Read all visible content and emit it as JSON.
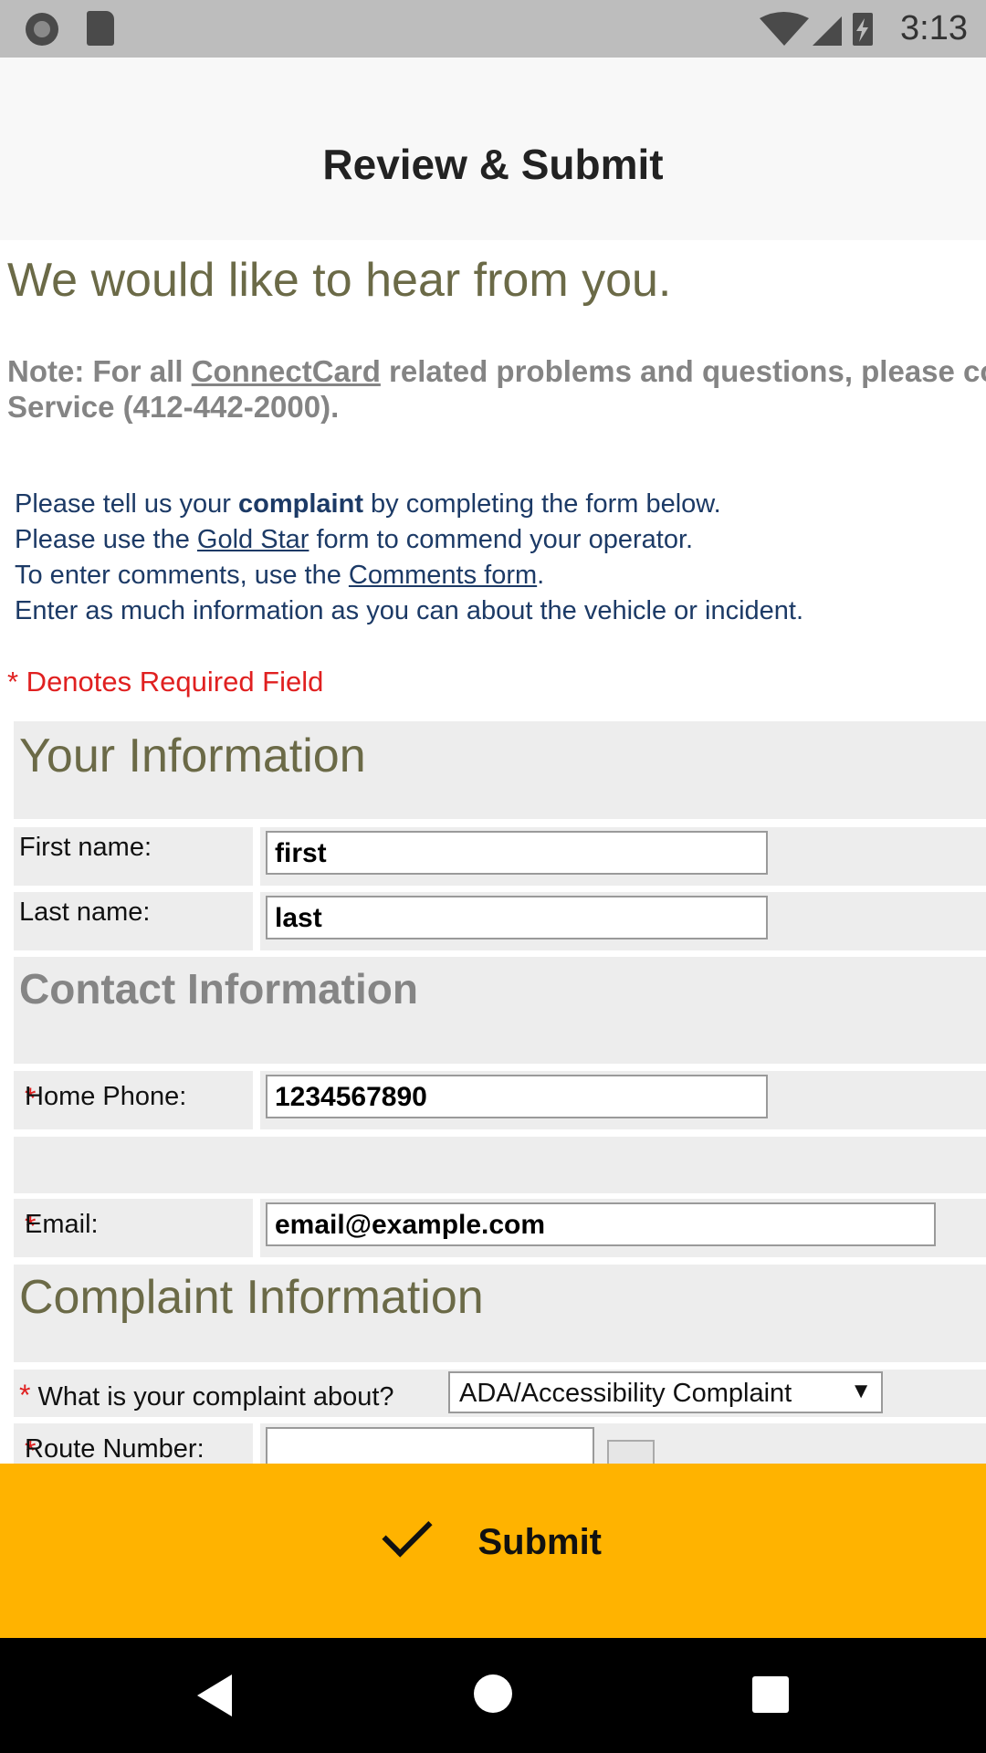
{
  "status_bar": {
    "time": "3:13",
    "icons": [
      "notification-circle-icon",
      "sd-card-icon",
      "wifi-icon",
      "signal-icon",
      "battery-charging-icon"
    ]
  },
  "header": {
    "title": "Review & Submit"
  },
  "intro": {
    "heading": "We would like to hear from you.",
    "note_prefix": "Note: For all ",
    "note_link": "ConnectCard",
    "note_line1_rest": " related problems and questions, please cont",
    "note_line2": "Service (412-442-2000).",
    "line1_a": "Please tell us your ",
    "line1_bold": "complaint",
    "line1_b": " by completing the form below.",
    "line2_a": "Please use the ",
    "line2_link": "Gold Star",
    "line2_b": " form to commend your operator.",
    "line3_a": "To enter comments, use the ",
    "line3_link": "Comments form",
    "line3_b": ".",
    "line4": "Enter as much information as you can about the vehicle or incident."
  },
  "required_note": "* Denotes Required Field",
  "sections": {
    "your_info": "Your Information",
    "contact_info": "Contact Information",
    "complaint_info": "Complaint Information"
  },
  "fields": {
    "first_name": {
      "label": "First name:",
      "value": "first"
    },
    "last_name": {
      "label": "Last name:",
      "value": "last"
    },
    "home_phone": {
      "label": "Home Phone:",
      "value": "1234567890",
      "required": "*"
    },
    "email": {
      "label": "Email:",
      "value": "email@example.com",
      "required": "*"
    },
    "complaint_about": {
      "label": "What is your complaint about?",
      "selected": "ADA/Accessibility Complaint",
      "required": "*"
    },
    "route_number": {
      "label": "Route Number:",
      "value": "",
      "required": "*"
    }
  },
  "submit": {
    "label": "Submit"
  },
  "colors": {
    "accent": "#ffb300",
    "heading_olive": "#6b6a47",
    "required_red": "#e02020",
    "link_navy": "#1c3a66"
  }
}
